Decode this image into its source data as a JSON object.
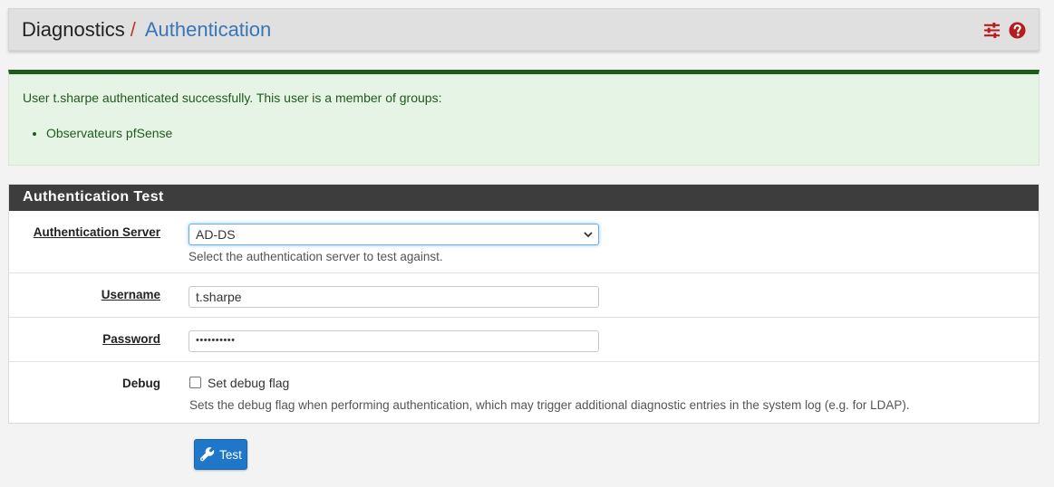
{
  "breadcrumb": {
    "parent": "Diagnostics",
    "separator": "/",
    "current": "Authentication"
  },
  "header_icons": [
    "settings-sliders-icon",
    "help-circle-icon"
  ],
  "colors": {
    "accent_red": "#c0392b",
    "link_blue": "#3776b8",
    "success_green": "#1e5c1e",
    "button_blue": "#1f77c9",
    "panel_heading": "#3d3d3d"
  },
  "alert": {
    "message": "User t.sharpe authenticated successfully. This user is a member of groups:",
    "groups": [
      "Observateurs pfSense"
    ]
  },
  "panel": {
    "title": "Authentication Test",
    "fields": {
      "server": {
        "label": "Authentication Server",
        "value": "AD-DS",
        "help": "Select the authentication server to test against."
      },
      "username": {
        "label": "Username",
        "value": "t.sharpe"
      },
      "password": {
        "label": "Password",
        "value": "••••••••••"
      },
      "debug": {
        "label": "Debug",
        "checkbox_label": "Set debug flag",
        "checked": false,
        "help": "Sets the debug flag when performing authentication, which may trigger additional diagnostic entries in the system log (e.g. for LDAP)."
      }
    }
  },
  "test_button": {
    "label": "Test",
    "icon": "wrench-icon"
  }
}
